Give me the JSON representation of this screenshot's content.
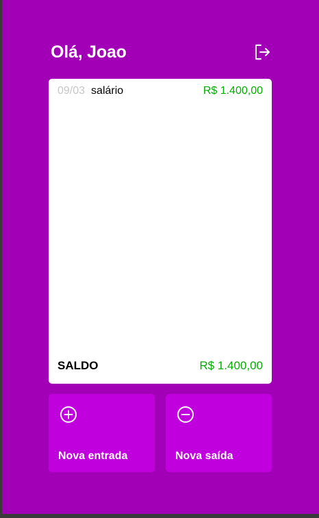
{
  "header": {
    "greeting": "Olá, Joao",
    "logout_icon": "logout-icon"
  },
  "records": {
    "items": [
      {
        "date": "09/03",
        "description": "salário",
        "value": "R$ 1.400,00",
        "type": "income"
      }
    ],
    "balance_label": "SALDO",
    "balance_value": "R$ 1.400,00"
  },
  "actions": {
    "new_entry": {
      "label": "Nova entrada",
      "icon": "plus-circle-icon"
    },
    "new_exit": {
      "label": "Nova saída",
      "icon": "minus-circle-icon"
    }
  },
  "colors": {
    "background": "#a100b7",
    "button": "#c100de",
    "income": "#03ac00",
    "date": "#c6c6c6"
  }
}
